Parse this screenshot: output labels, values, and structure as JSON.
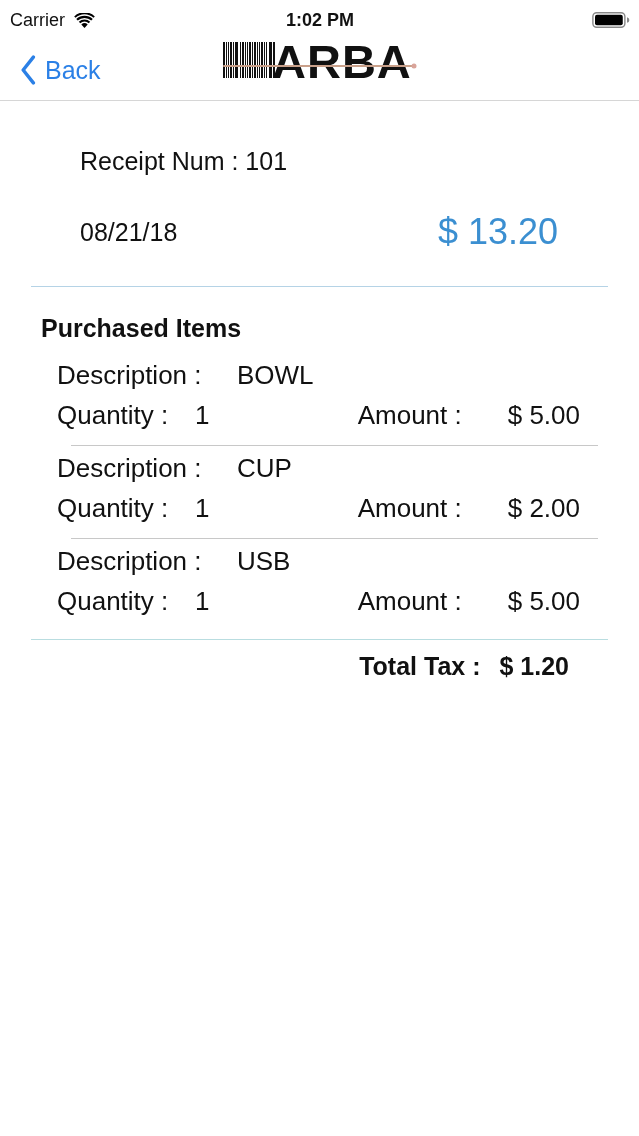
{
  "status_bar": {
    "carrier": "Carrier",
    "time": "1:02 PM"
  },
  "nav_bar": {
    "back_label": "Back",
    "logo_text": "ARBA"
  },
  "receipt": {
    "number_label": "Receipt Num : 101",
    "date": "08/21/18",
    "total": "$ 13.20"
  },
  "purchased_items": {
    "title": "Purchased Items",
    "items": [
      {
        "description_label": "Description :",
        "description": "BOWL",
        "quantity_label": "Quantity :",
        "quantity": "1",
        "amount_label": "Amount :",
        "amount": "$ 5.00"
      },
      {
        "description_label": "Description :",
        "description": "CUP",
        "quantity_label": "Quantity :",
        "quantity": "1",
        "amount_label": "Amount :",
        "amount": "$ 2.00"
      },
      {
        "description_label": "Description :",
        "description": "USB",
        "quantity_label": "Quantity :",
        "quantity": "1",
        "amount_label": "Amount :",
        "amount": "$ 5.00"
      }
    ]
  },
  "total_tax": {
    "label": "Total Tax :",
    "value": "$ 1.20"
  }
}
